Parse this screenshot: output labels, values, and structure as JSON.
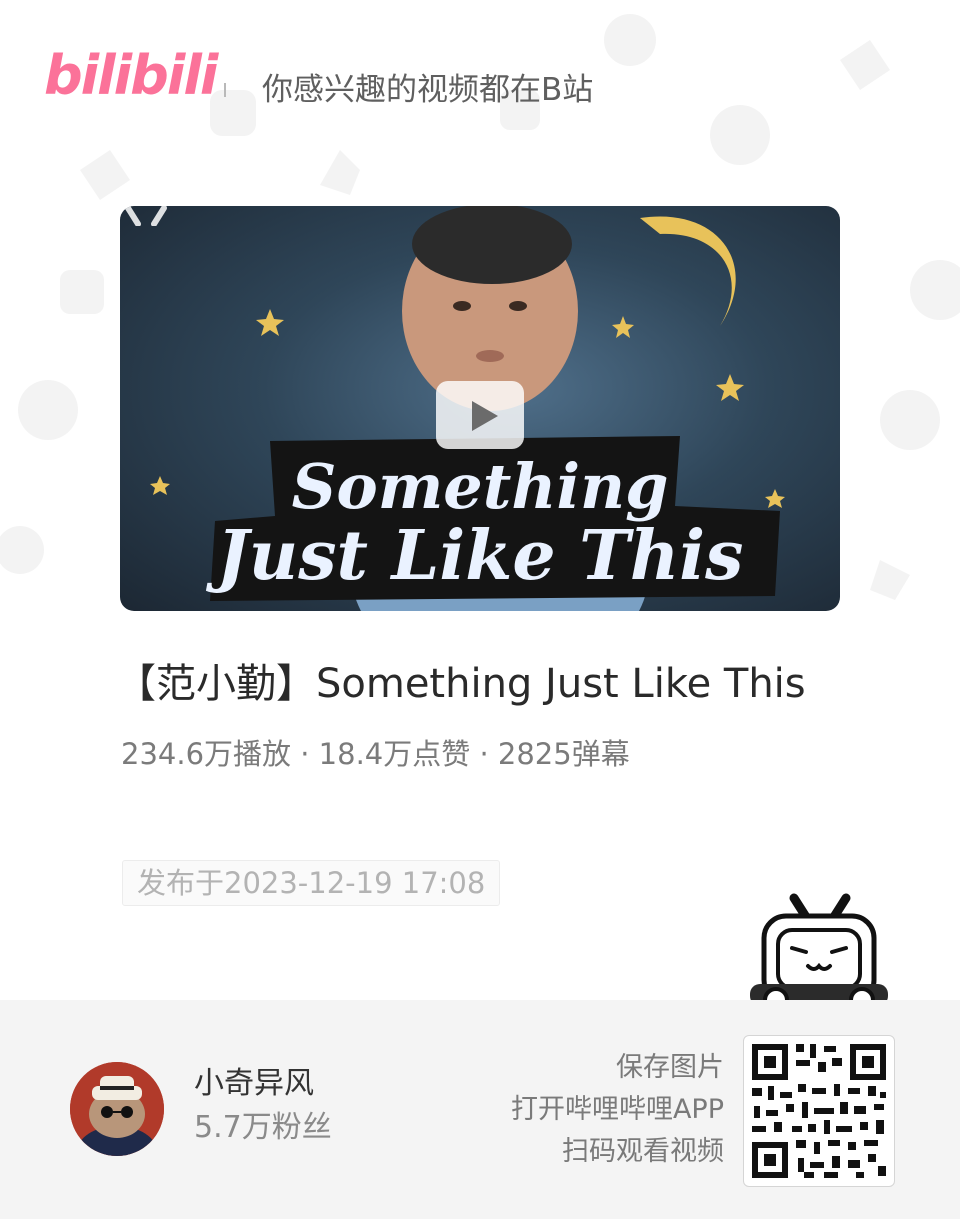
{
  "header": {
    "logo_text": "bilibili",
    "slogan": "你感兴趣的视频都在B站"
  },
  "video": {
    "cover_text_line1": "Something",
    "cover_text_line2": "Just Like This",
    "title": "【范小勤】Something Just Like This",
    "stats": "234.6万播放 · 18.4万点赞 · 2825弹幕",
    "publish_date": "发布于2023-12-19 17:08"
  },
  "author": {
    "name": "小奇异风",
    "fans": "5.7万粉丝"
  },
  "qr": {
    "line1": "保存图片",
    "line2": "打开哔哩哔哩APP",
    "line3": "扫码观看视频"
  },
  "colors": {
    "brand_pink": "#fb7299",
    "footer_bg": "#f4f4f4"
  },
  "icons": [
    "play-icon",
    "tv-mascot-icon",
    "qr-code"
  ]
}
